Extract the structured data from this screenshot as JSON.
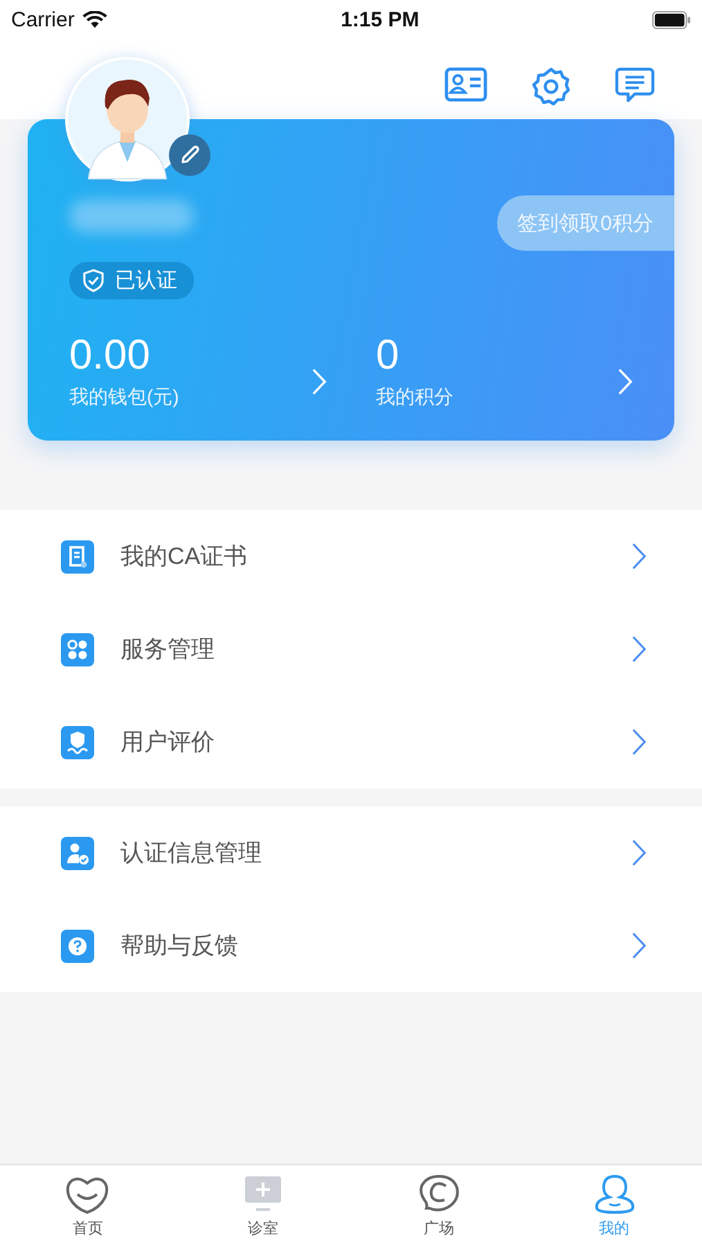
{
  "status_bar": {
    "carrier": "Carrier",
    "time": "1:15 PM"
  },
  "profile": {
    "verified": true,
    "verified_label": "已认证",
    "checkin": "签到领取0积分",
    "stats": [
      {
        "value": "0.00",
        "label": "我的钱包(元)"
      },
      {
        "value": "0",
        "label": "我的积分"
      }
    ]
  },
  "menu_groups": [
    [
      {
        "kind": "certificate",
        "label": "我的CA证书"
      },
      {
        "kind": "services",
        "label": "服务管理"
      },
      {
        "kind": "reviews",
        "label": "用户评价"
      }
    ],
    [
      {
        "kind": "verification",
        "label": "认证信息管理"
      },
      {
        "kind": "help",
        "label": "帮助与反馈"
      }
    ]
  ],
  "tabs": [
    {
      "kind": "home",
      "label": "首页",
      "selected": false
    },
    {
      "kind": "clinic",
      "label": "诊室",
      "selected": false
    },
    {
      "kind": "square",
      "label": "广场",
      "selected": false
    },
    {
      "kind": "me",
      "label": "我的",
      "selected": true
    }
  ]
}
